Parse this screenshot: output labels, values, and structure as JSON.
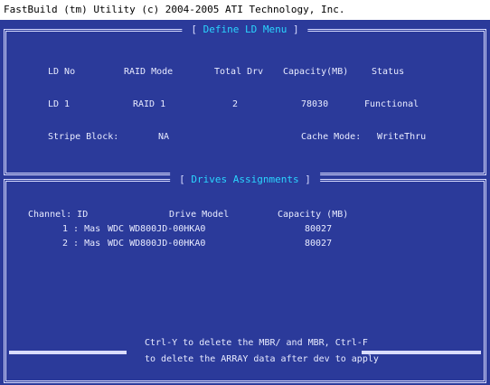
{
  "header": {
    "text": "FastBuild (tm) Utility (c) 2004-2005 ATI Technology, Inc."
  },
  "define_ld": {
    "title": "Define LD Menu",
    "columns": [
      "LD No",
      "RAID Mode",
      "Total Drv",
      "Capacity(MB)",
      "Status"
    ],
    "row": [
      "LD 1",
      "RAID 1",
      "2",
      "78030",
      "Functional"
    ],
    "stripe_label": "Stripe Block:",
    "stripe_value": "NA",
    "cache_label": "Cache Mode:",
    "cache_value": "WriteThru"
  },
  "drives": {
    "title": "Drives Assignments",
    "columns": [
      "Channel: ID",
      "Drive Model",
      "Capacity (MB)"
    ],
    "rows": [
      {
        "id": "1 : Mas",
        "model": "WDC WD800JD-00HKA0",
        "capacity": "80027"
      },
      {
        "id": "2 : Mas",
        "model": "WDC WD800JD-00HKA0",
        "capacity": "80027"
      }
    ]
  },
  "footer": {
    "line1": "Ctrl-Y to delete the MBR/ and MBR, Ctrl-F",
    "line2": "to delete the ARRAY data after dev to apply"
  }
}
